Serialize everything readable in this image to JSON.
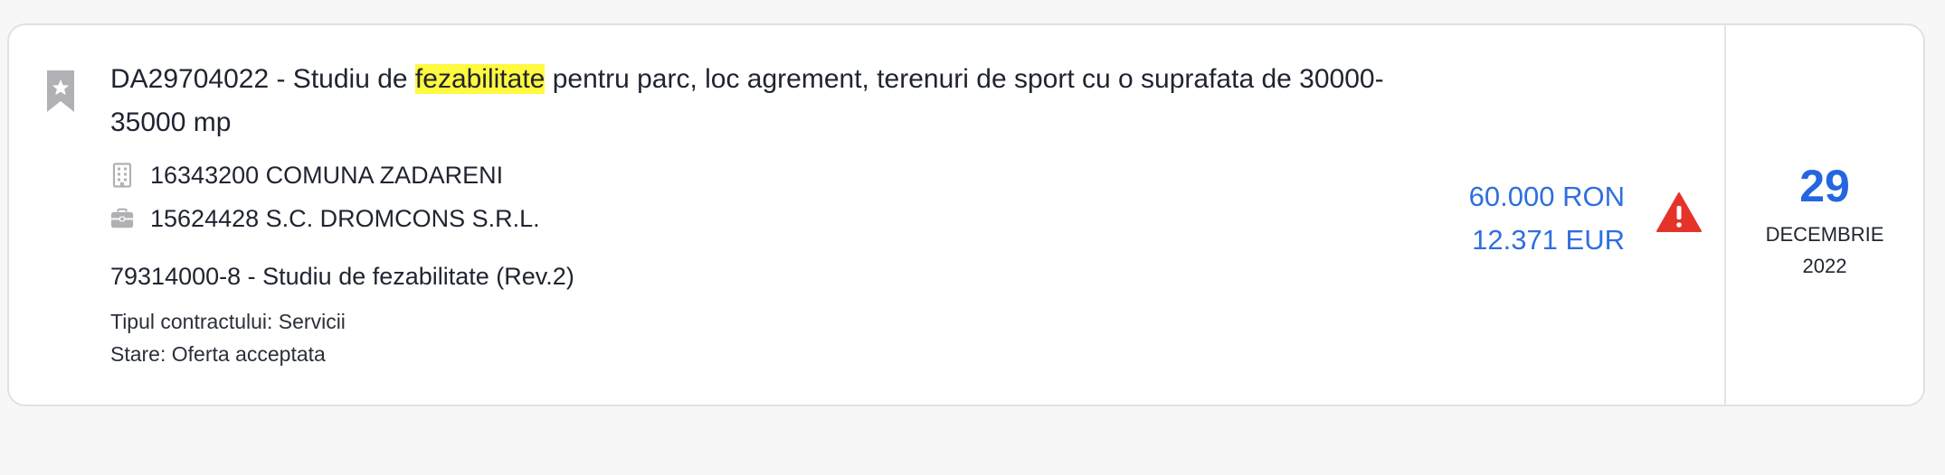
{
  "notice": {
    "title_before": "DA29704022 - Studiu de ",
    "title_highlight": "fezabilitate",
    "title_after": " pentru parc, loc agrement, terenuri de sport cu o suprafata de 30000-35000 mp",
    "authority": "16343200 COMUNA ZADARENI",
    "supplier": "15624428 S.C. DROMCONS S.R.L.",
    "cpv": "79314000-8 - Studiu de fezabilitate (Rev.2)",
    "contract_type_label": "Tipul contractului: ",
    "contract_type_value": "Servicii",
    "status_label": "Stare: ",
    "status_value": "Oferta acceptata"
  },
  "price": {
    "ron": "60.000 RON",
    "eur": "12.371 EUR"
  },
  "date": {
    "day": "29",
    "month": "DECEMBRIE",
    "year": "2022"
  },
  "colors": {
    "accent": "#2f6fe0",
    "highlight": "#fff940",
    "warning": "#e5332a",
    "icon_gray": "#b0b0b5"
  },
  "icons": {
    "bookmark": "bookmark-star-icon",
    "building": "building-icon",
    "briefcase": "briefcase-icon",
    "warning": "warning-icon"
  }
}
